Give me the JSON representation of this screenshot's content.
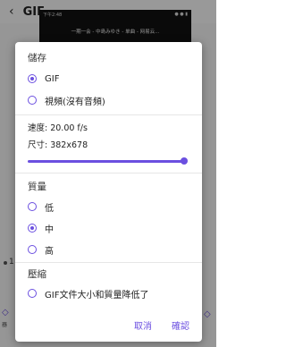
{
  "background": {
    "back_icon": "chevron-left-icon",
    "title": "GIF",
    "video_status_time": "下午2:48",
    "video_ticker": "一期一会 - 中島みゆき - 单曲 - 网易云...",
    "timeline_number": "1",
    "left_label": "器"
  },
  "dialog": {
    "storage": {
      "title": "儲存",
      "options": [
        {
          "label": "GIF",
          "checked": true
        },
        {
          "label": "視頻(沒有音頻)",
          "checked": false
        }
      ]
    },
    "speed_text": "速度: 20.00 f/s",
    "size_text": "尺寸: 382x678",
    "slider_value": 1.0,
    "quality": {
      "title": "質量",
      "options": [
        {
          "label": "低",
          "checked": false
        },
        {
          "label": "中",
          "checked": true
        },
        {
          "label": "高",
          "checked": false
        }
      ]
    },
    "compress": {
      "title": "壓縮",
      "checkbox_label": "GIF文件大小和質量降低了",
      "checked": false
    },
    "actions": {
      "cancel": "取消",
      "confirm": "確認"
    }
  },
  "colors": {
    "accent": "#6b4fe0",
    "scrim": "rgba(0,0,0,0.40)"
  }
}
